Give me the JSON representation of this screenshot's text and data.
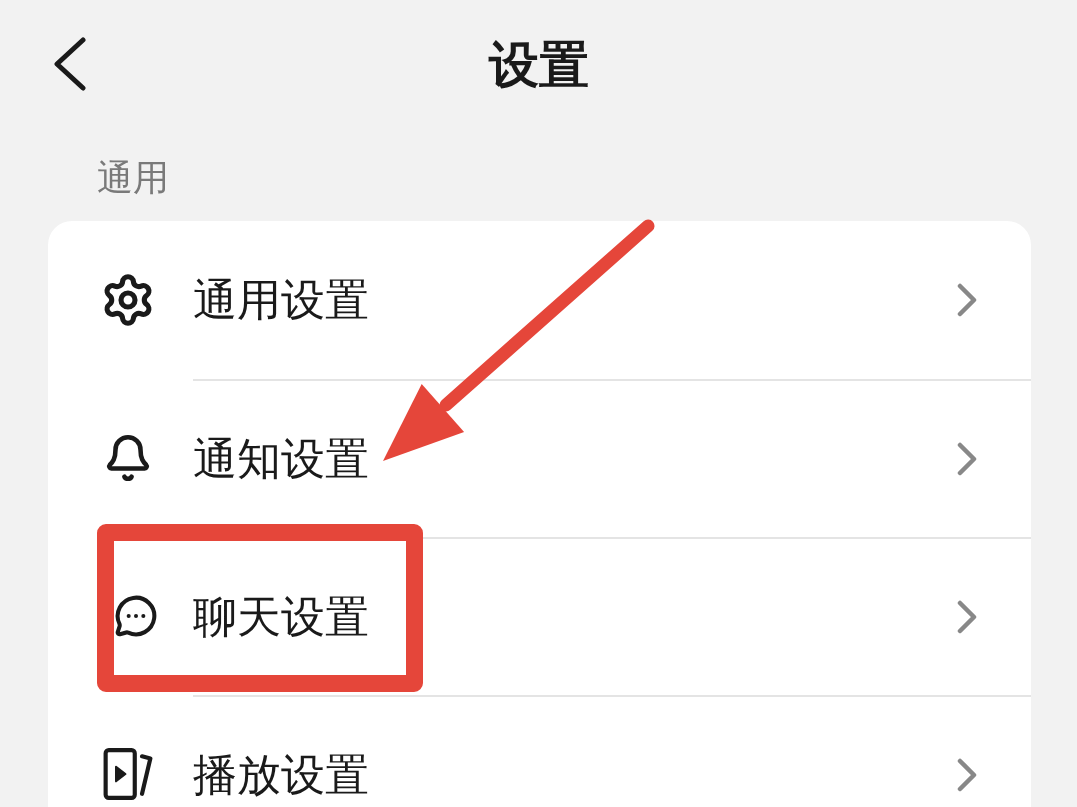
{
  "header": {
    "title": "设置"
  },
  "sections": [
    {
      "label": "通用",
      "rows": [
        {
          "kind": "gear",
          "label": "通用设置",
          "pointed": false,
          "highlighted": false
        },
        {
          "kind": "bell",
          "label": "通知设置",
          "pointed": true,
          "highlighted": false
        },
        {
          "kind": "chat",
          "label": "聊天设置",
          "pointed": false,
          "highlighted": true
        },
        {
          "kind": "play",
          "label": "播放设置",
          "pointed": false,
          "highlighted": false
        }
      ]
    }
  ]
}
